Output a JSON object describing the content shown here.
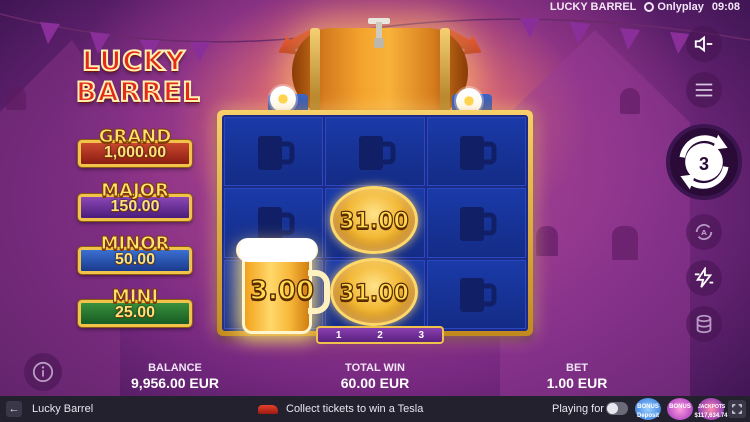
{
  "status": {
    "title": "LUCKY BARREL",
    "provider": "Onlyplay",
    "time": "09:08"
  },
  "logo": {
    "line1": "LUCKY",
    "line2": "BARREL"
  },
  "jackpots": [
    {
      "name": "GRAND",
      "value": "1,000.00"
    },
    {
      "name": "MAJOR",
      "value": "150.00"
    },
    {
      "name": "MINOR",
      "value": "50.00"
    },
    {
      "name": "MINI",
      "value": "25.00"
    }
  ],
  "reels": {
    "coins": [
      "31.00",
      "31.00"
    ],
    "beer_value": "3.00",
    "columns": [
      "1",
      "2",
      "3"
    ]
  },
  "controls": {
    "sound_icon": "speaker-muted-icon",
    "menu_icon": "hamburger-menu-icon",
    "spins_left": "3",
    "autoplay_icon": "autoplay-icon",
    "turbo_icon": "lightning-icon",
    "bet_icon": "coin-stack-icon"
  },
  "stats": {
    "balance_label": "BALANCE",
    "balance_value": "9,956.00 EUR",
    "total_win_label": "TOTAL WIN",
    "total_win_value": "60.00 EUR",
    "bet_label": "BET",
    "bet_value": "1.00 EUR"
  },
  "footer": {
    "game_name": "Lucky Barrel",
    "promo": "Collect tickets to win a Tesla",
    "real_play_label": "Playing for real",
    "badges": [
      {
        "top": "BONUS",
        "caption": "Deposit"
      },
      {
        "top": "BONUS",
        "caption": ""
      },
      {
        "top": "JACKPOTS",
        "caption": "$117,634.74"
      }
    ]
  },
  "colors": {
    "reel_bg": "#1c2a86",
    "frame_gold": "#f2c34a",
    "coin_gold": "#f2b834",
    "footer_bg": "#23212e"
  }
}
